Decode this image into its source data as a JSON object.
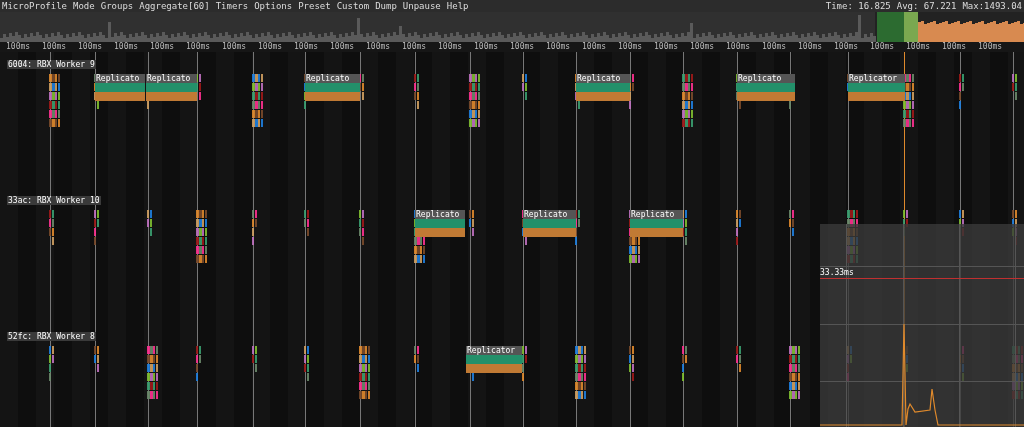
{
  "menu": [
    "MicroProfile",
    "Mode",
    "Groups",
    "Aggregate[60]",
    "Timers",
    "Options",
    "Preset",
    "Custom",
    "Dump",
    "Unpause",
    "Help"
  ],
  "stats": [
    "Time: 16.825",
    "Avg: 67.221",
    "Max:1493.04"
  ],
  "ruler": [
    "100ms",
    "100ms",
    "100ms",
    "100ms",
    "100ms",
    "100ms",
    "100ms",
    "100ms",
    "100ms",
    "100ms",
    "100ms",
    "100ms",
    "100ms",
    "100ms",
    "100ms",
    "100ms",
    "100ms",
    "100ms",
    "100ms",
    "100ms",
    "100ms",
    "100ms",
    "100ms",
    "100ms",
    "100ms",
    "100ms",
    "100ms",
    "100ms"
  ],
  "threads": [
    {
      "label": "6004: RBX Worker 9",
      "blocks": [
        "Replicato",
        "Replicato",
        "Replicato",
        "Replicato",
        "Replicato",
        "Replicator"
      ]
    },
    {
      "label": "33ac: RBX Worker 10",
      "blocks": [
        "Replicato",
        "Replicato",
        "Replicato"
      ]
    },
    {
      "label": "52fc: RBX Worker 8",
      "blocks": [
        "Replicator"
      ]
    }
  ],
  "graph": {
    "threshold": "33.33ms"
  }
}
